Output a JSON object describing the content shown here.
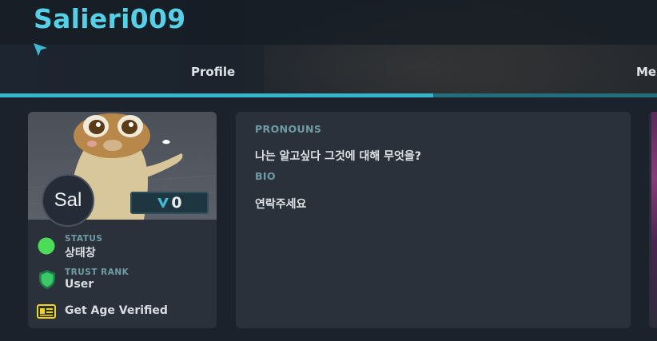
{
  "header": {
    "username": "Salieri009"
  },
  "tabs": [
    {
      "label": "Profile"
    },
    {
      "label": "Me"
    }
  ],
  "profile_card": {
    "avatar_initials": "Sal",
    "currency_value": "0",
    "status": {
      "label": "STATUS",
      "value": "상태창"
    },
    "trust_rank": {
      "label": "TRUST RANK",
      "value": "User"
    },
    "age_verify": {
      "label": "Get Age Verified"
    }
  },
  "about": {
    "pronouns_label": "PRONOUNS",
    "pronouns_value": "나는 알고싶다 그것에 대해 무엇을?",
    "bio_label": "BIO",
    "bio_value": "연락주세요"
  },
  "colors": {
    "accent": "#34b5cb",
    "username": "#55d0e6",
    "status_online": "#4cdc5a",
    "trust_shield": "#3cc86a",
    "age_icon": "#f5cf22",
    "card_bg": "#2b313b",
    "page_bg": "#1b222c"
  },
  "icons": {
    "cursor": "cursor-arrow-icon",
    "currency": "vrchat-v-icon",
    "status": "status-dot-icon",
    "trust": "shield-icon",
    "age": "id-card-icon"
  }
}
